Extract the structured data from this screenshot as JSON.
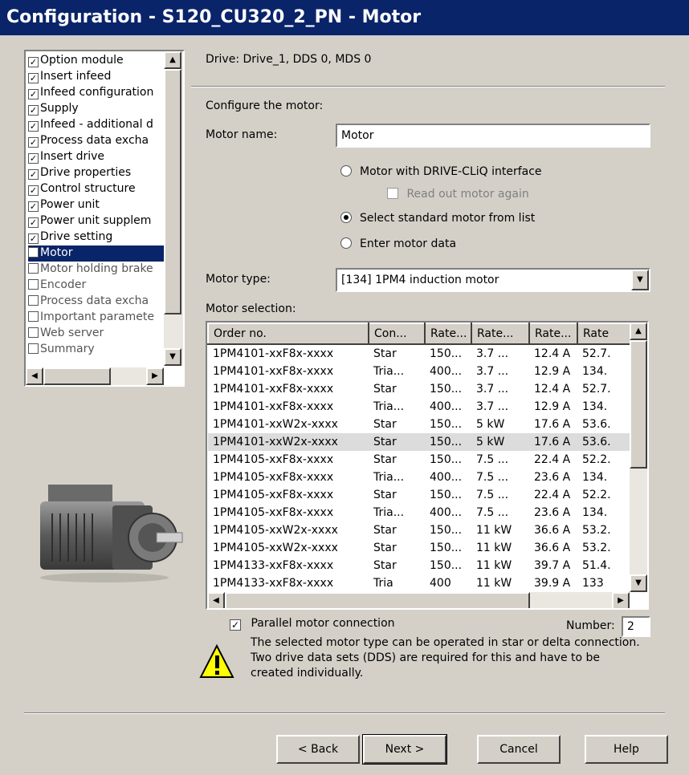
{
  "window": {
    "title": "Configuration - S120_CU320_2_PN - Motor"
  },
  "nav": {
    "items": [
      {
        "label": "Option module",
        "checked": true
      },
      {
        "label": "Insert infeed",
        "checked": true
      },
      {
        "label": "Infeed configuration",
        "checked": true
      },
      {
        "label": "Supply",
        "checked": true
      },
      {
        "label": "Infeed - additional d",
        "checked": true
      },
      {
        "label": "Process data excha",
        "checked": true
      },
      {
        "label": "Insert drive",
        "checked": true
      },
      {
        "label": "Drive properties",
        "checked": true
      },
      {
        "label": "Control structure",
        "checked": true
      },
      {
        "label": "Power unit",
        "checked": true
      },
      {
        "label": "Power unit supplem",
        "checked": true
      },
      {
        "label": "Drive setting",
        "checked": true
      },
      {
        "label": "Motor",
        "checked": false
      },
      {
        "label": "Motor holding brake",
        "checked": false
      },
      {
        "label": "Encoder",
        "checked": false
      },
      {
        "label": "Process data excha",
        "checked": false
      },
      {
        "label": "Important paramete",
        "checked": false
      },
      {
        "label": "Web server",
        "checked": false
      },
      {
        "label": "Summary",
        "checked": false
      }
    ]
  },
  "header": {
    "drive_info": "Drive: Drive_1, DDS 0, MDS 0"
  },
  "form": {
    "configure_label": "Configure the motor:",
    "motor_name_label": "Motor name:",
    "motor_name_value": "Motor",
    "radio_driveclic": "Motor with DRIVE-CLiQ interface",
    "check_readout": "Read out motor again",
    "radio_standard": "Select standard motor from list",
    "radio_enter": "Enter motor data",
    "motor_type_label": "Motor type:",
    "motor_type_value": "[134] 1PM4 induction motor",
    "motor_selection_label": "Motor selection:"
  },
  "table": {
    "headers": [
      "Order no.",
      "Con...",
      "Rate...",
      "Rate...",
      "Rate...",
      "Rate"
    ],
    "rows": [
      [
        "1PM4101-xxF8x-xxxx",
        "Star",
        "150...",
        "3.7 ...",
        "12.4 A",
        "52.7."
      ],
      [
        "1PM4101-xxF8x-xxxx",
        "Tria...",
        "400...",
        "3.7 ...",
        "12.9 A",
        "134."
      ],
      [
        "1PM4101-xxF8x-xxxx",
        "Star",
        "150...",
        "3.7 ...",
        "12.4 A",
        "52.7."
      ],
      [
        "1PM4101-xxF8x-xxxx",
        "Tria...",
        "400...",
        "3.7 ...",
        "12.9 A",
        "134."
      ],
      [
        "1PM4101-xxW2x-xxxx",
        "Star",
        "150...",
        "5 kW",
        "17.6 A",
        "53.6."
      ],
      [
        "1PM4101-xxW2x-xxxx",
        "Star",
        "150...",
        "5 kW",
        "17.6 A",
        "53.6."
      ],
      [
        "1PM4105-xxF8x-xxxx",
        "Star",
        "150...",
        "7.5 ...",
        "22.4 A",
        "52.2."
      ],
      [
        "1PM4105-xxF8x-xxxx",
        "Tria...",
        "400...",
        "7.5 ...",
        "23.6 A",
        "134."
      ],
      [
        "1PM4105-xxF8x-xxxx",
        "Star",
        "150...",
        "7.5 ...",
        "22.4 A",
        "52.2."
      ],
      [
        "1PM4105-xxF8x-xxxx",
        "Tria...",
        "400...",
        "7.5 ...",
        "23.6 A",
        "134."
      ],
      [
        "1PM4105-xxW2x-xxxx",
        "Star",
        "150...",
        "11 kW",
        "36.6 A",
        "53.2."
      ],
      [
        "1PM4105-xxW2x-xxxx",
        "Star",
        "150...",
        "11 kW",
        "36.6 A",
        "53.2."
      ],
      [
        "1PM4133-xxF8x-xxxx",
        "Star",
        "150...",
        "11 kW",
        "39.7 A",
        "51.4."
      ],
      [
        "1PM4133-xxF8x-xxxx",
        "Tria",
        "400",
        "11 kW",
        "39.9 A",
        "133"
      ]
    ]
  },
  "parallel": {
    "label": "Parallel motor connection",
    "number_label": "Number:",
    "number_value": "2",
    "warning": "The selected motor type can be operated in star or delta connection. Two drive data sets (DDS) are required for this and have to be created individually."
  },
  "buttons": {
    "back": "< Back",
    "next": "Next >",
    "cancel": "Cancel",
    "help": "Help"
  }
}
